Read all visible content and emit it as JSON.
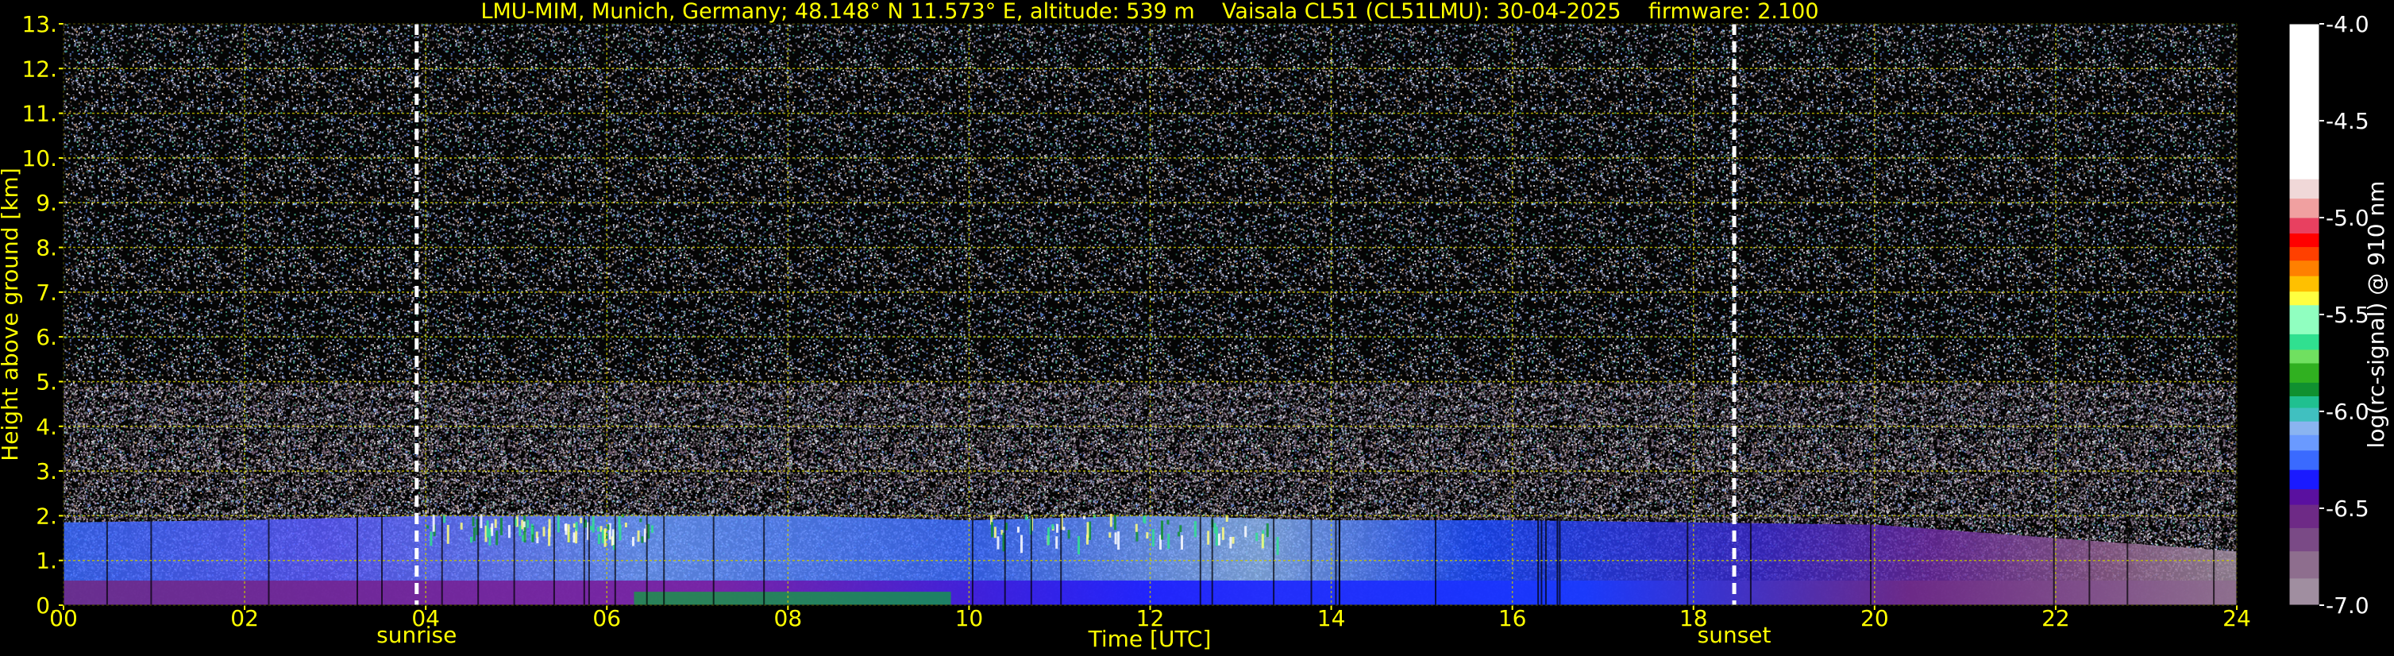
{
  "title": "LMU-MIM, Munich, Germany; 48.148° N 11.573° E, altitude: 539 m    Vaisala CL51 (CL51LMU): 30-04-2025    firmware: 2.100",
  "colors": {
    "background": "#000000",
    "text": "#ffff00",
    "grid": "#c8c800",
    "marker": "#ffffff",
    "colorbar_text": "#ffffff"
  },
  "chart_data": {
    "type": "heatmap",
    "xlabel": "Time [UTC]",
    "ylabel": "Height above ground [km]",
    "x_ticks": [
      "00",
      "02",
      "04",
      "06",
      "08",
      "10",
      "12",
      "14",
      "16",
      "18",
      "20",
      "22",
      "24"
    ],
    "y_ticks": [
      "0.",
      "1.",
      "2.",
      "3.",
      "4.",
      "5.",
      "6.",
      "7.",
      "8.",
      "9.",
      "10.",
      "11.",
      "12.",
      "13."
    ],
    "xlim": [
      0,
      24
    ],
    "ylim": [
      0,
      13
    ],
    "grid": true,
    "markers": [
      {
        "label": "sunrise",
        "x": 3.9
      },
      {
        "label": "sunset",
        "x": 18.45
      }
    ],
    "colorbar": {
      "label": "log(rc-signal) @ 910 nm",
      "ticks": [
        "-4.0",
        "-4.5",
        "-5.0",
        "-5.5",
        "-6.0",
        "-6.5",
        "-7.0"
      ],
      "range": [
        -7.0,
        -4.0
      ],
      "colors": [
        "#a08ea0",
        "#8e6e8e",
        "#7a4a86",
        "#6e2a86",
        "#5a10a0",
        "#1a1aff",
        "#3a6aff",
        "#6a9aff",
        "#8ab4f0",
        "#40c0c0",
        "#20c090",
        "#109030",
        "#30b020",
        "#70e060",
        "#30e090",
        "#90ffc0",
        "#ffff40",
        "#ffc000",
        "#ff8000",
        "#ff4000",
        "#ff0000",
        "#e84060",
        "#f0a0a0",
        "#f0d8d8",
        "#ffffff"
      ],
      "levels": [
        -7.0,
        -6.86,
        -6.72,
        -6.6,
        -6.48,
        -6.4,
        -6.3,
        -6.2,
        -6.12,
        -6.05,
        -5.98,
        -5.92,
        -5.85,
        -5.75,
        -5.68,
        -5.6,
        -5.45,
        -5.38,
        -5.3,
        -5.22,
        -5.15,
        -5.08,
        -5.0,
        -4.9,
        -4.8
      ]
    },
    "boundary_layer_top_km": [
      [
        0,
        1.85
      ],
      [
        2,
        1.9
      ],
      [
        4,
        2.0
      ],
      [
        6,
        2.0
      ],
      [
        8,
        2.0
      ],
      [
        10,
        1.9
      ],
      [
        12,
        2.0
      ],
      [
        14,
        1.9
      ],
      [
        16,
        1.9
      ],
      [
        18,
        1.85
      ],
      [
        20,
        1.8
      ],
      [
        22,
        1.5
      ],
      [
        24,
        1.2
      ]
    ]
  }
}
